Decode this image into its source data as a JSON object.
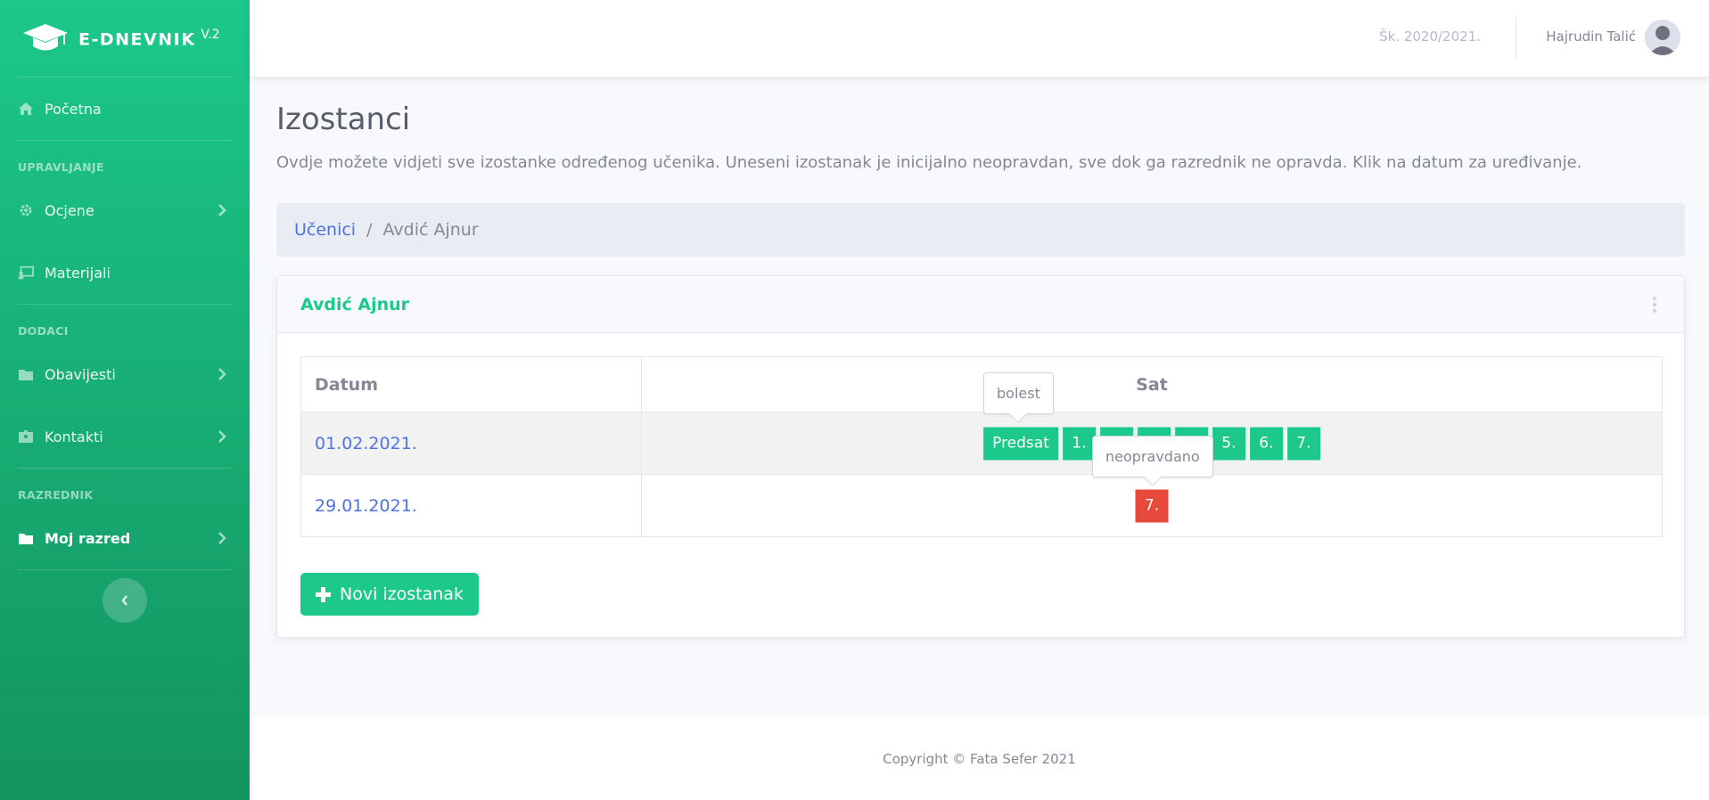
{
  "brand": {
    "name": "E-DNEVNIK",
    "version": "V.2",
    "logo_icon": "graduation-cap-icon"
  },
  "sidebar": {
    "items": [
      {
        "label": "Početna",
        "icon": "home-icon"
      },
      {
        "heading": "UPRAVLJANJE"
      },
      {
        "label": "Ocjene",
        "icon": "gear-icon",
        "has_submenu": true
      },
      {
        "label": "Materijali",
        "icon": "chalkboard-icon"
      },
      {
        "heading": "DODACI"
      },
      {
        "label": "Obavijesti",
        "icon": "folder-icon",
        "has_submenu": true
      },
      {
        "label": "Kontakti",
        "icon": "address-card-icon",
        "has_submenu": true
      },
      {
        "heading": "RAZREDNIK"
      },
      {
        "label": "Moj razred",
        "icon": "folder-icon",
        "has_submenu": true,
        "active": true
      }
    ],
    "toggle_icon": "chevron-left-icon"
  },
  "topbar": {
    "school_year": "Šk. 2020/2021.",
    "user_name": "Hajrudin Talić"
  },
  "page": {
    "title": "Izostanci",
    "description": "Ovdje možete vidjeti sve izostanke određenog učenika. Uneseni izostanak je inicijalno neopravdan, sve dok ga razrednik ne opravda. Klik na datum za uređivanje."
  },
  "breadcrumb": {
    "link": "Učenici",
    "separator": "/",
    "current": "Avdić Ajnur"
  },
  "card": {
    "title": "Avdić Ajnur",
    "table": {
      "headers": [
        "Datum",
        "Sat"
      ],
      "rows": [
        {
          "date": "01.02.2021.",
          "hours": [
            "Predsat",
            "1.",
            "",
            "",
            "",
            "5.",
            "6.",
            "7."
          ]
        },
        {
          "date": "29.01.2021.",
          "hours": [
            "7."
          ]
        }
      ]
    },
    "tooltips": {
      "first": "bolest",
      "second": "neopravdano"
    },
    "new_button": "Novi izostanak"
  },
  "footer": {
    "copyright": "Copyright © Fata Sefer 2021"
  },
  "colors": {
    "primary": "#1cc88a",
    "danger": "#e74a3b",
    "link": "#4e73df"
  }
}
